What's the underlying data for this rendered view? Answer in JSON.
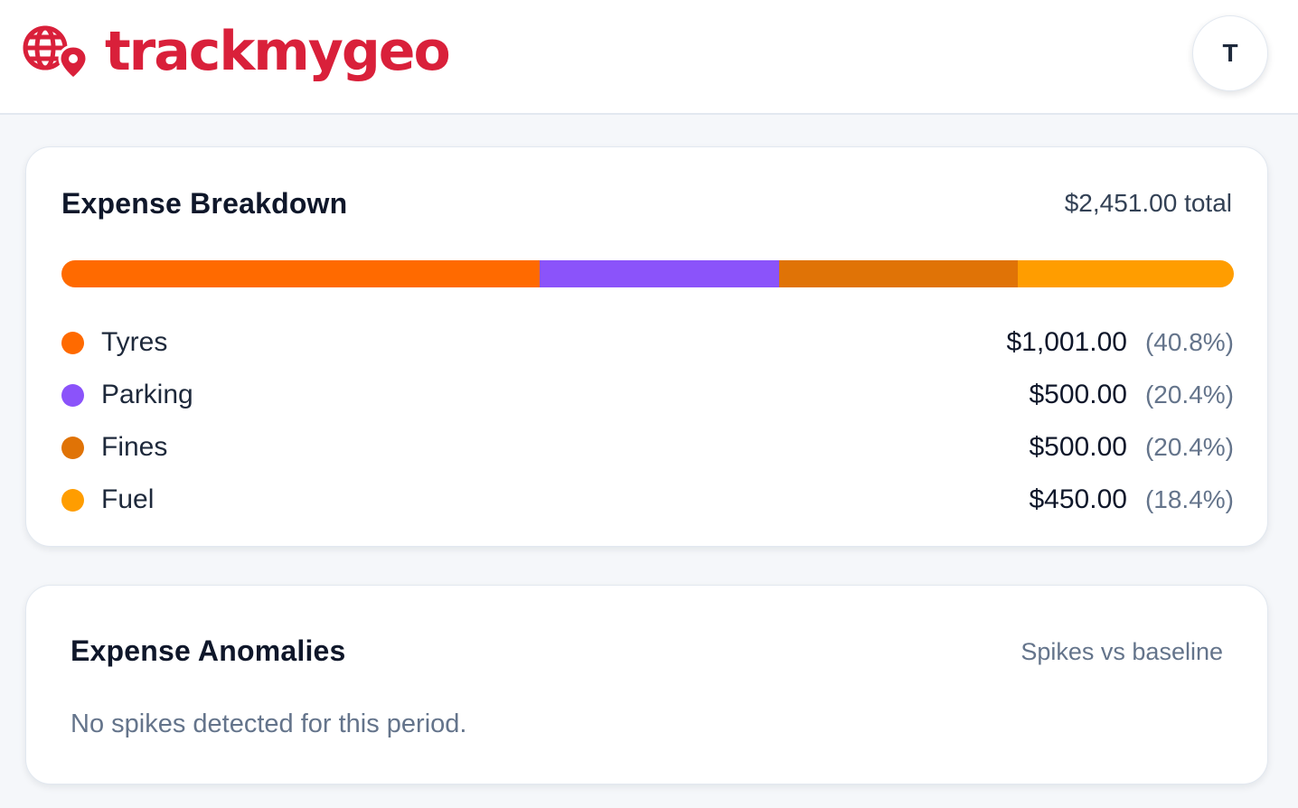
{
  "brand": {
    "name": "trackmygeo",
    "color": "#d9203a"
  },
  "user": {
    "avatar_initial": "T"
  },
  "breakdown": {
    "title": "Expense Breakdown",
    "total_label": "$2,451.00 total",
    "items": [
      {
        "label": "Tyres",
        "amount": "$1,001.00",
        "percent": "(40.8%)",
        "share": 40.8,
        "color": "#ff6a00"
      },
      {
        "label": "Parking",
        "amount": "$500.00",
        "percent": "(20.4%)",
        "share": 20.4,
        "color": "#8b53fa"
      },
      {
        "label": "Fines",
        "amount": "$500.00",
        "percent": "(20.4%)",
        "share": 20.4,
        "color": "#e07306"
      },
      {
        "label": "Fuel",
        "amount": "$450.00",
        "percent": "(18.4%)",
        "share": 18.4,
        "color": "#ff9d00"
      }
    ]
  },
  "anomalies": {
    "title": "Expense Anomalies",
    "subtitle": "Spikes vs baseline",
    "empty_message": "No spikes detected for this period."
  }
}
